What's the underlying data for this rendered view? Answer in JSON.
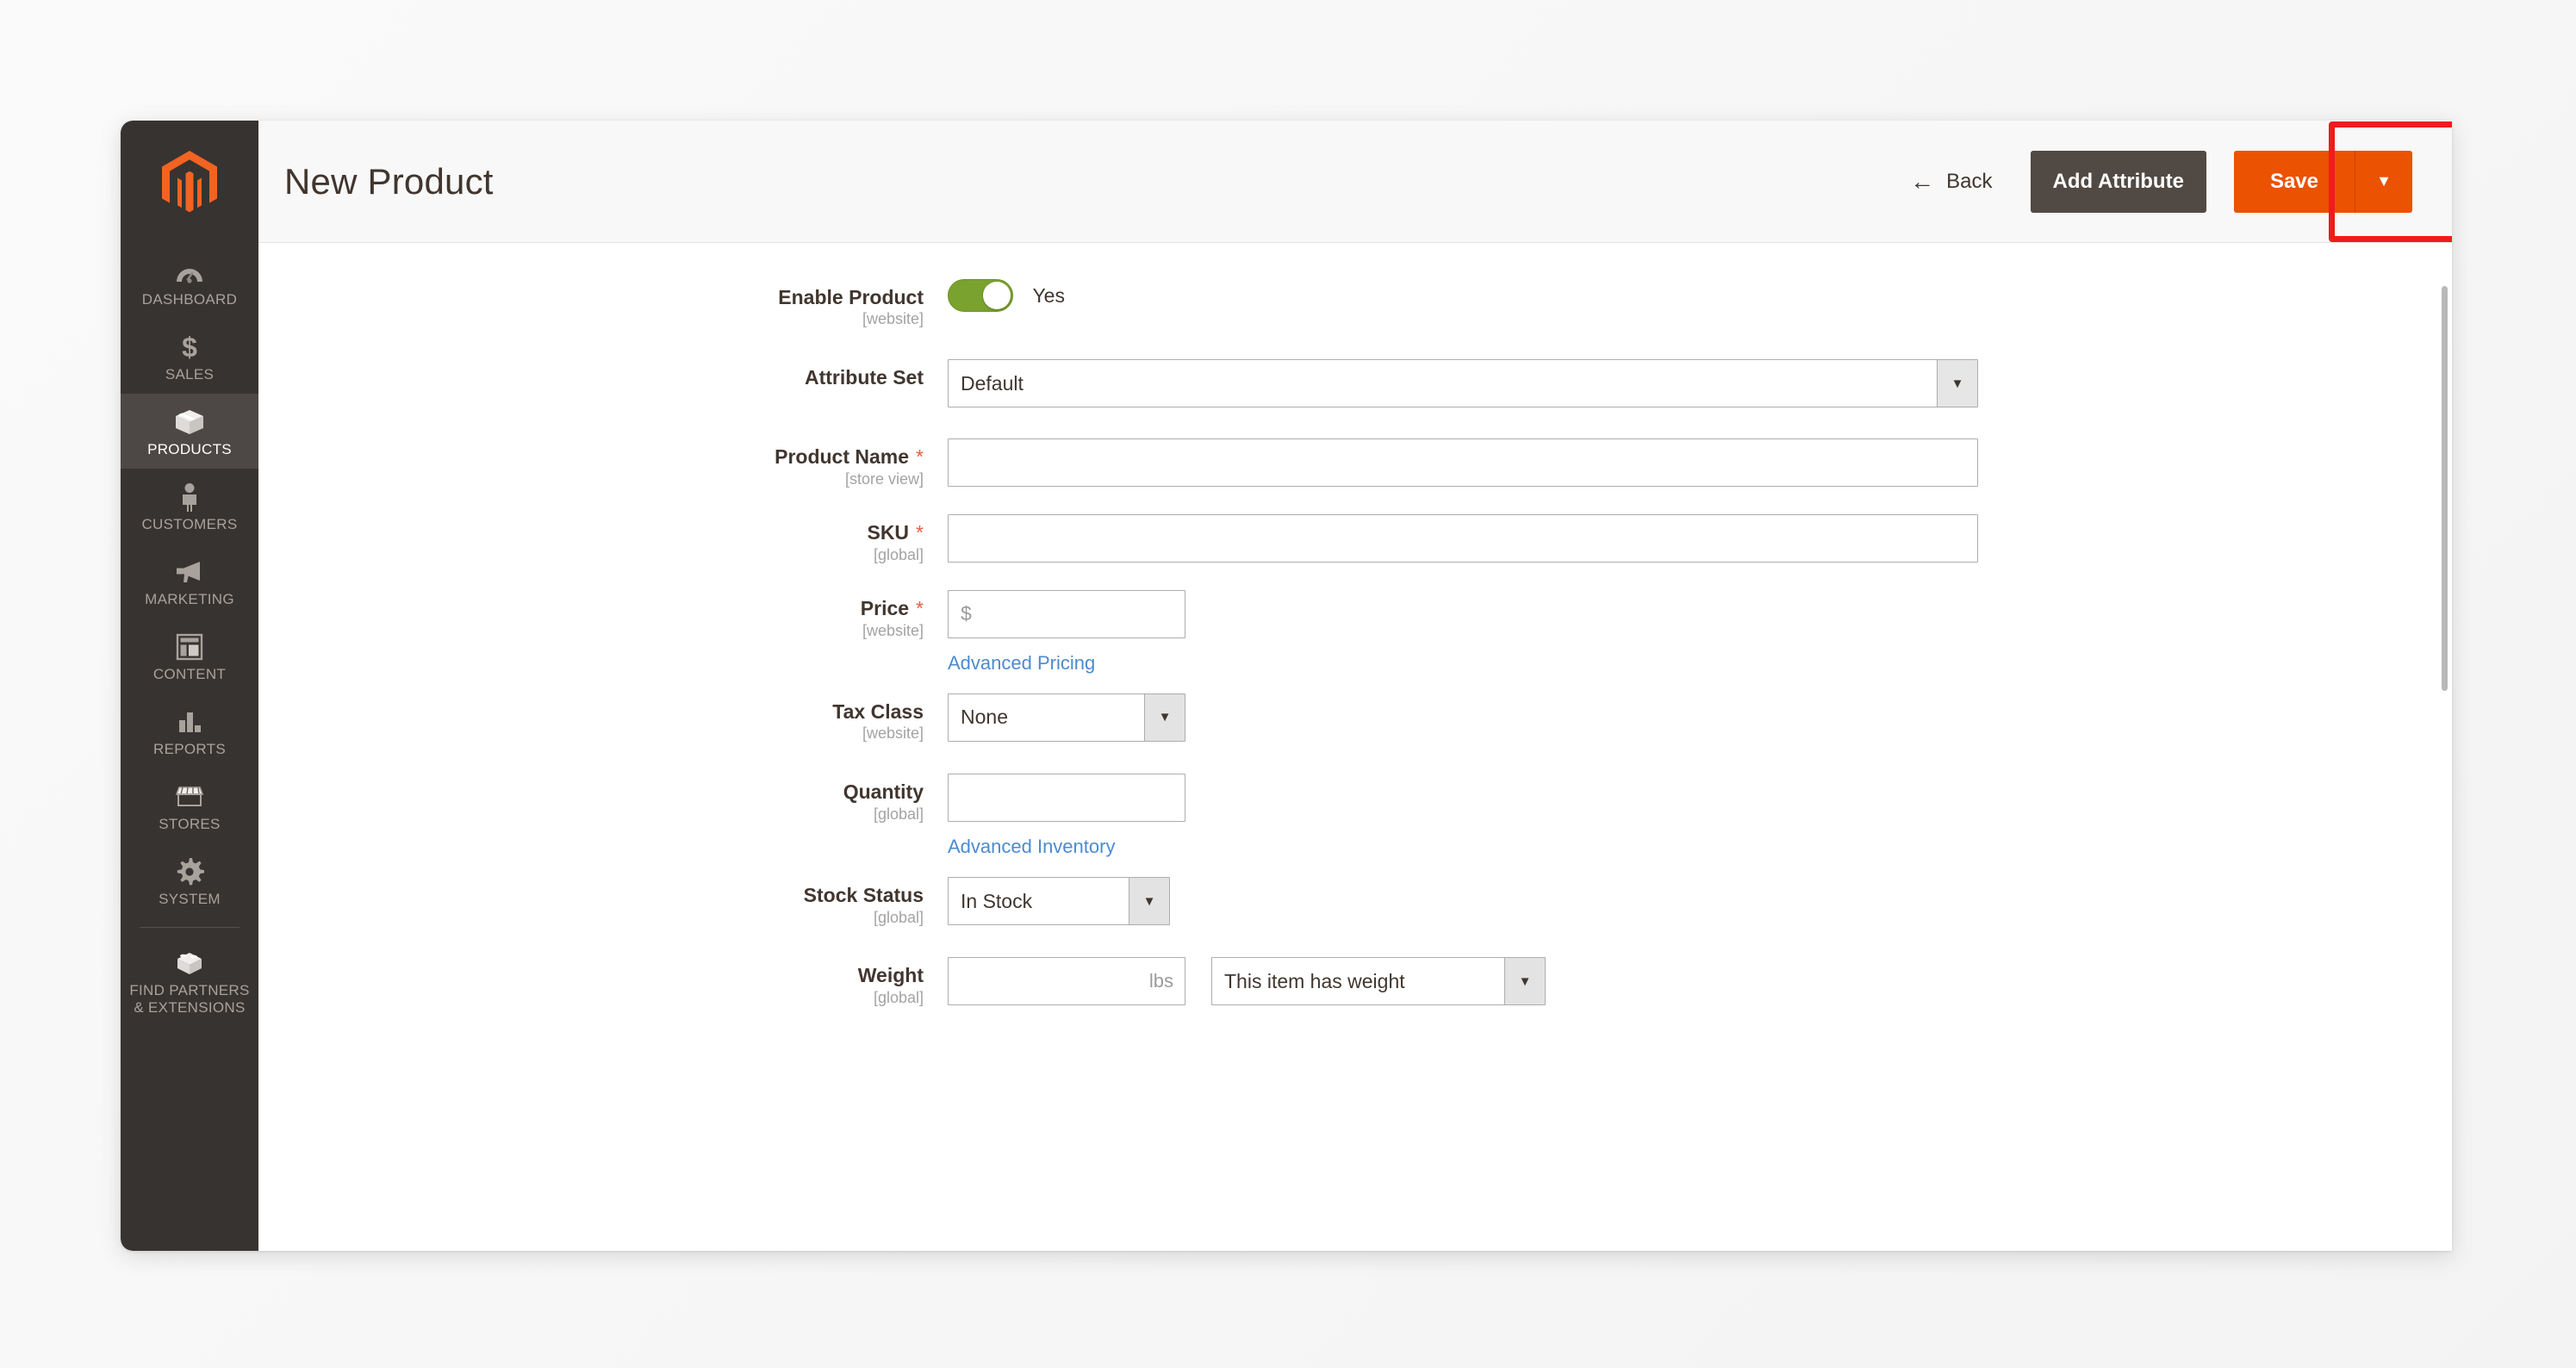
{
  "app": {
    "logo_name": "magento-logo-icon"
  },
  "sidebar": {
    "items": [
      {
        "label": "DASHBOARD",
        "icon": "dashboard-gauge-icon",
        "active": false
      },
      {
        "label": "SALES",
        "icon": "dollar-sign-icon",
        "active": false
      },
      {
        "label": "PRODUCTS",
        "icon": "box-icon",
        "active": true
      },
      {
        "label": "CUSTOMERS",
        "icon": "person-icon",
        "active": false
      },
      {
        "label": "MARKETING",
        "icon": "megaphone-icon",
        "active": false
      },
      {
        "label": "CONTENT",
        "icon": "layout-page-icon",
        "active": false
      },
      {
        "label": "REPORTS",
        "icon": "bar-chart-icon",
        "active": false
      },
      {
        "label": "STORES",
        "icon": "storefront-icon",
        "active": false
      },
      {
        "label": "SYSTEM",
        "icon": "gear-icon",
        "active": false
      },
      {
        "label": "FIND PARTNERS\n& EXTENSIONS",
        "icon": "extension-box-icon",
        "active": false
      }
    ]
  },
  "header": {
    "title": "New Product",
    "back_label": "Back",
    "back_icon": "arrow-left-icon",
    "add_attribute_label": "Add Attribute",
    "save_label": "Save",
    "save_caret_icon": "chevron-down-icon",
    "highlight_color": "#f01c1c",
    "save_color": "#eb5202"
  },
  "form": {
    "enable_product": {
      "label": "Enable Product",
      "scope": "[website]",
      "toggle_state": "Yes",
      "toggle_color": "#79a22e"
    },
    "attribute_set": {
      "label": "Attribute Set",
      "scope": "",
      "value": "Default"
    },
    "product_name": {
      "label": "Product Name",
      "scope": "[store view]",
      "required": "*",
      "value": "",
      "placeholder": ""
    },
    "sku": {
      "label": "SKU",
      "scope": "[global]",
      "required": "*",
      "value": "",
      "placeholder": ""
    },
    "price": {
      "label": "Price",
      "scope": "[website]",
      "required": "*",
      "value": "",
      "placeholder": "$",
      "link_label": "Advanced Pricing"
    },
    "tax_class": {
      "label": "Tax Class",
      "scope": "[website]",
      "value": "None"
    },
    "quantity": {
      "label": "Quantity",
      "scope": "[global]",
      "value": "",
      "placeholder": "",
      "link_label": "Advanced Inventory"
    },
    "stock_status": {
      "label": "Stock Status",
      "scope": "[global]",
      "value": "In Stock"
    },
    "weight": {
      "label": "Weight",
      "scope": "[global]",
      "value": "",
      "unit": "lbs",
      "has_weight_value": "This item has weight"
    }
  }
}
